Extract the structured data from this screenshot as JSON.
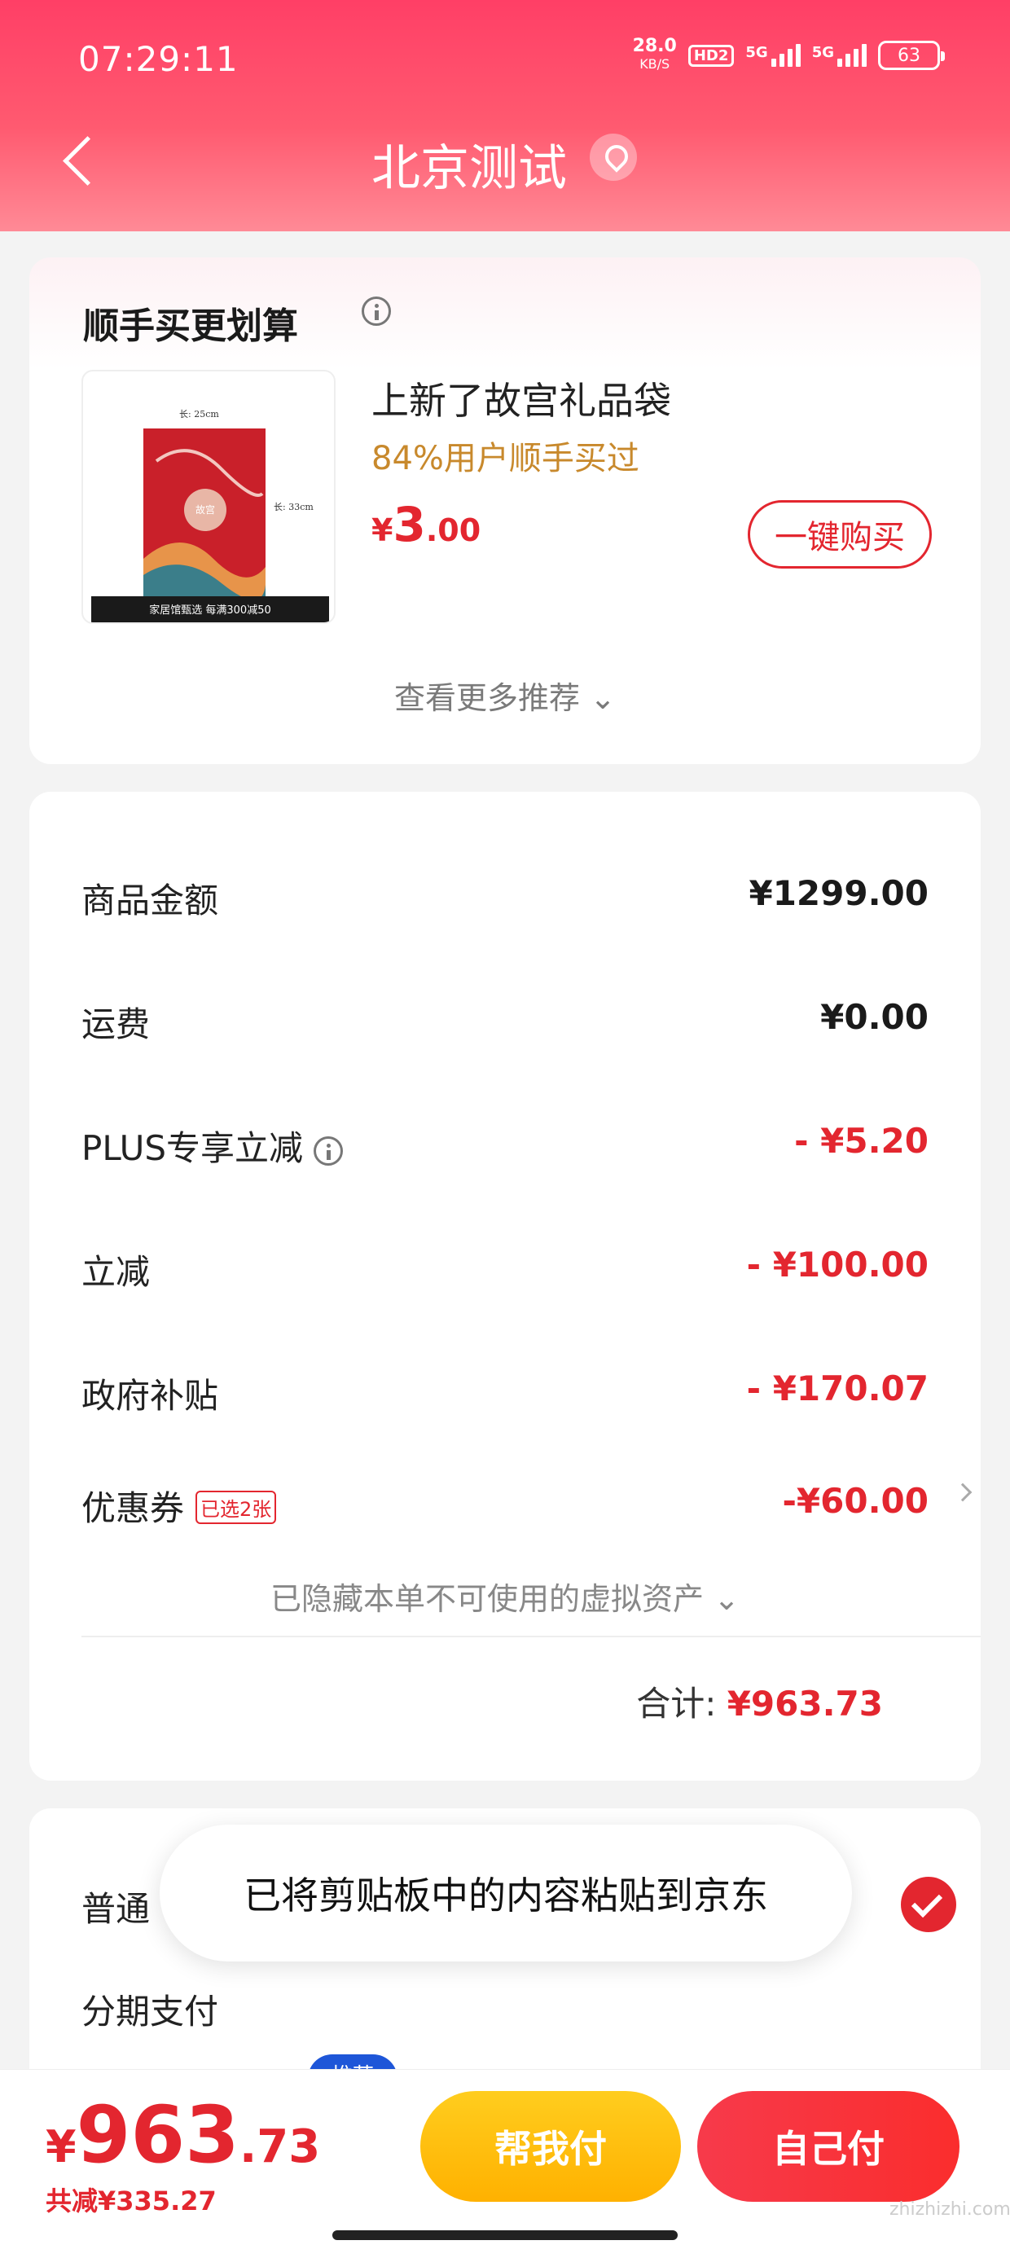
{
  "status_bar": {
    "time": "07:29:11",
    "net_speed": "28.0",
    "net_unit": "KB/S",
    "hd": "HD2",
    "sim1": "5G",
    "sim2": "5G",
    "battery": "63"
  },
  "nav": {
    "back_icon": "chevron-left-icon",
    "title": "北京测试",
    "location_icon": "location-pin-icon"
  },
  "recommend": {
    "title": "顺手买更划算",
    "product_name": "上新了故宫礼品袋",
    "product_sub": "84%用户顺手买过",
    "price_symbol": "¥",
    "price_int": "3",
    "price_dec": ".00",
    "buy_button": "一键购买",
    "more": "查看更多推荐",
    "image": {
      "size_top": "长: 25cm",
      "size_side": "长: 33cm",
      "brand": "故宫",
      "banner": "家居馆甄选 每满300减50"
    }
  },
  "summary": {
    "rows": [
      {
        "label": "商品金额",
        "value": "¥1299.00"
      },
      {
        "label": "运费",
        "value": "¥0.00"
      },
      {
        "label": "PLUS专享立减",
        "value": "- ¥5.20"
      },
      {
        "label": "立减",
        "value": "- ¥100.00"
      },
      {
        "label": "政府补贴",
        "value": "- ¥170.07"
      },
      {
        "label": "优惠券",
        "badge": "已选2张",
        "value": "-¥60.00"
      }
    ],
    "hidden_note": "已隐藏本单不可使用的虚拟资产",
    "total_label": "合计:",
    "total_value": "¥963.73"
  },
  "payment": {
    "option1": "普通",
    "option2": "分期支付",
    "tag": "推荐"
  },
  "toast": "已将剪贴板中的内容粘贴到京东",
  "bottom": {
    "price_symbol": "¥",
    "price_int": "963",
    "price_dec": ".73",
    "saved": "共减¥335.27",
    "help_pay": "帮我付",
    "self_pay": "自己付"
  },
  "watermark": "zhizhizhi.com",
  "colors": {
    "accent_red": "#e3262f",
    "header_pink": "#ff4d6b",
    "gold": "#c8892c",
    "help_yellow": "#ffbe0f"
  }
}
